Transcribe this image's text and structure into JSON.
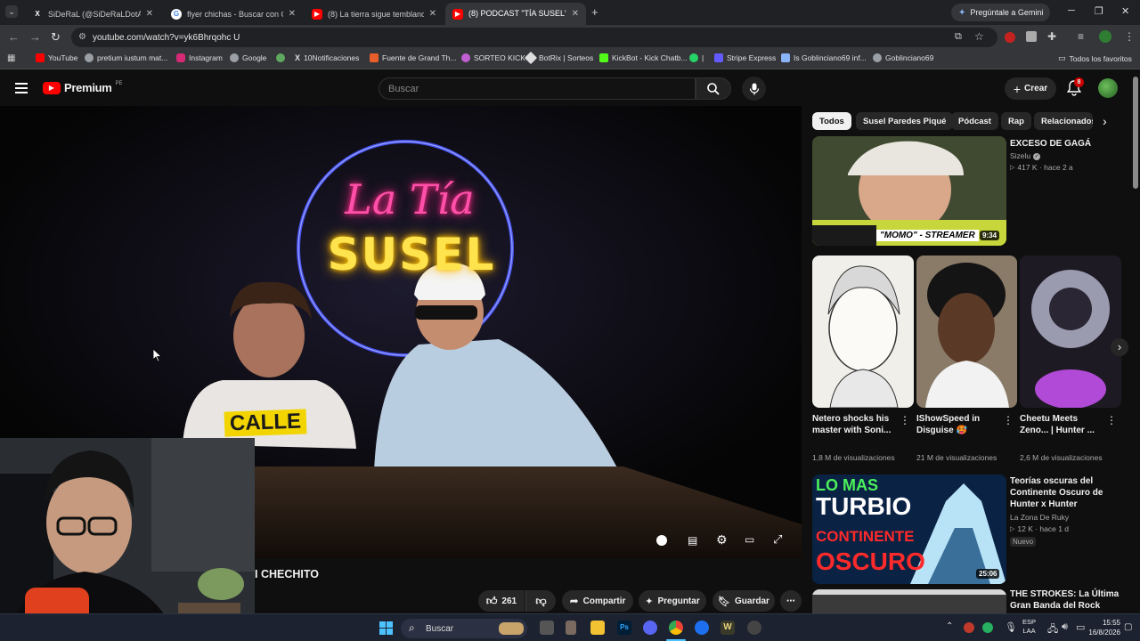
{
  "browser": {
    "tabs": [
      {
        "title": "SiDeRaL (@SiDeRaLDotA) / X",
        "active": false
      },
      {
        "title": "flyer chichas - Buscar con Goog",
        "active": false
      },
      {
        "title": "(8) La tierra sigue temblando: A",
        "active": false
      },
      {
        "title": "(8) PODCAST \"TÍA SUSEL\" 🎙 |",
        "active": true
      }
    ],
    "new_tab": "+",
    "gemini_label": "Pregúntale a Gemini",
    "url": "youtube.com/watch?v=yk6Bhrqohc U",
    "bookmarks": [
      {
        "label": "YouTube",
        "color": "#ff0000"
      },
      {
        "label": "pretium iustum mat...",
        "color": "#9aa0a6"
      },
      {
        "label": "Instagram",
        "color": "#d62976"
      },
      {
        "label": "Google",
        "color": "#9aa0a6"
      },
      {
        "label": "",
        "color": "#9aa0a6"
      },
      {
        "label": "10Notificaciones",
        "color": "#ffffff"
      },
      {
        "label": "Fuente de Grand Th...",
        "color": "#e85d2c"
      },
      {
        "label": "SORTEO KICK",
        "color": "#c060d0"
      },
      {
        "label": "BotRix | Sorteos",
        "color": "#dddddd"
      },
      {
        "label": "KickBot - Kick Chatb...",
        "color": "#53fc18"
      },
      {
        "label": "|",
        "color": "#25d366"
      },
      {
        "label": "Stripe Express",
        "color": "#635bff"
      },
      {
        "label": "Is Goblinciano69 inf...",
        "color": "#8ab4f8"
      },
      {
        "label": "Goblinciano69",
        "color": "#9aa0a6"
      }
    ],
    "all_bookmarks": "Todos los favoritos"
  },
  "youtube": {
    "logo_text": "Premium",
    "logo_region": "PE",
    "search_placeholder": "Buscar",
    "create_label": "Crear",
    "notification_count": "8"
  },
  "player": {
    "neon_line1": "La Tía",
    "neon_line2": "SUSEL",
    "shirt_text": "CALLE"
  },
  "video": {
    "title_fragment": "I CHECHITO",
    "like_count": "261",
    "share_label": "Compartir",
    "ask_label": "Preguntar",
    "save_label": "Guardar",
    "more_label": "⋯"
  },
  "sidebar": {
    "chips": [
      "Todos",
      "Susel Paredes Piqué",
      "Pódcast",
      "Rap",
      "Relacionados"
    ],
    "featured": {
      "title": "EXCESO DE GAGÁ",
      "channel": "Sizelu",
      "meta": "417 K · hace 2 a",
      "thumb_caption": "\"MOMO\" - STREAMER",
      "duration": "9:34"
    },
    "shorts": [
      {
        "title": "Netero shocks his master with Soni...",
        "views": "1,8 M de visualizaciones"
      },
      {
        "title": "IShowSpeed in Disguise 🥵",
        "views": "21 M de visualizaciones"
      },
      {
        "title": "Cheetu Meets Zeno... | Hunter ...",
        "views": "2,6 M de visualizaciones"
      }
    ],
    "videos": [
      {
        "title": "Teorías oscuras del Continente Oscuro de Hunter x Hunter",
        "channel": "La Zona De Ruky",
        "meta": "12 K · hace 1 d",
        "badge": "Nuevo",
        "thumb_line1": "LO MAS",
        "thumb_line2": "TURBIO",
        "thumb_line3": "CONTINENTE",
        "thumb_line4": "OSCURO",
        "duration": "25:06"
      },
      {
        "title": "THE STROKES: La Última Gran Banda del Rock",
        "channel": "",
        "meta": ""
      }
    ]
  },
  "taskbar": {
    "search_label": "Buscar",
    "lang_line1": "ESP",
    "lang_line2": "LAA",
    "time": "15:55",
    "date": "16/8/2026"
  }
}
